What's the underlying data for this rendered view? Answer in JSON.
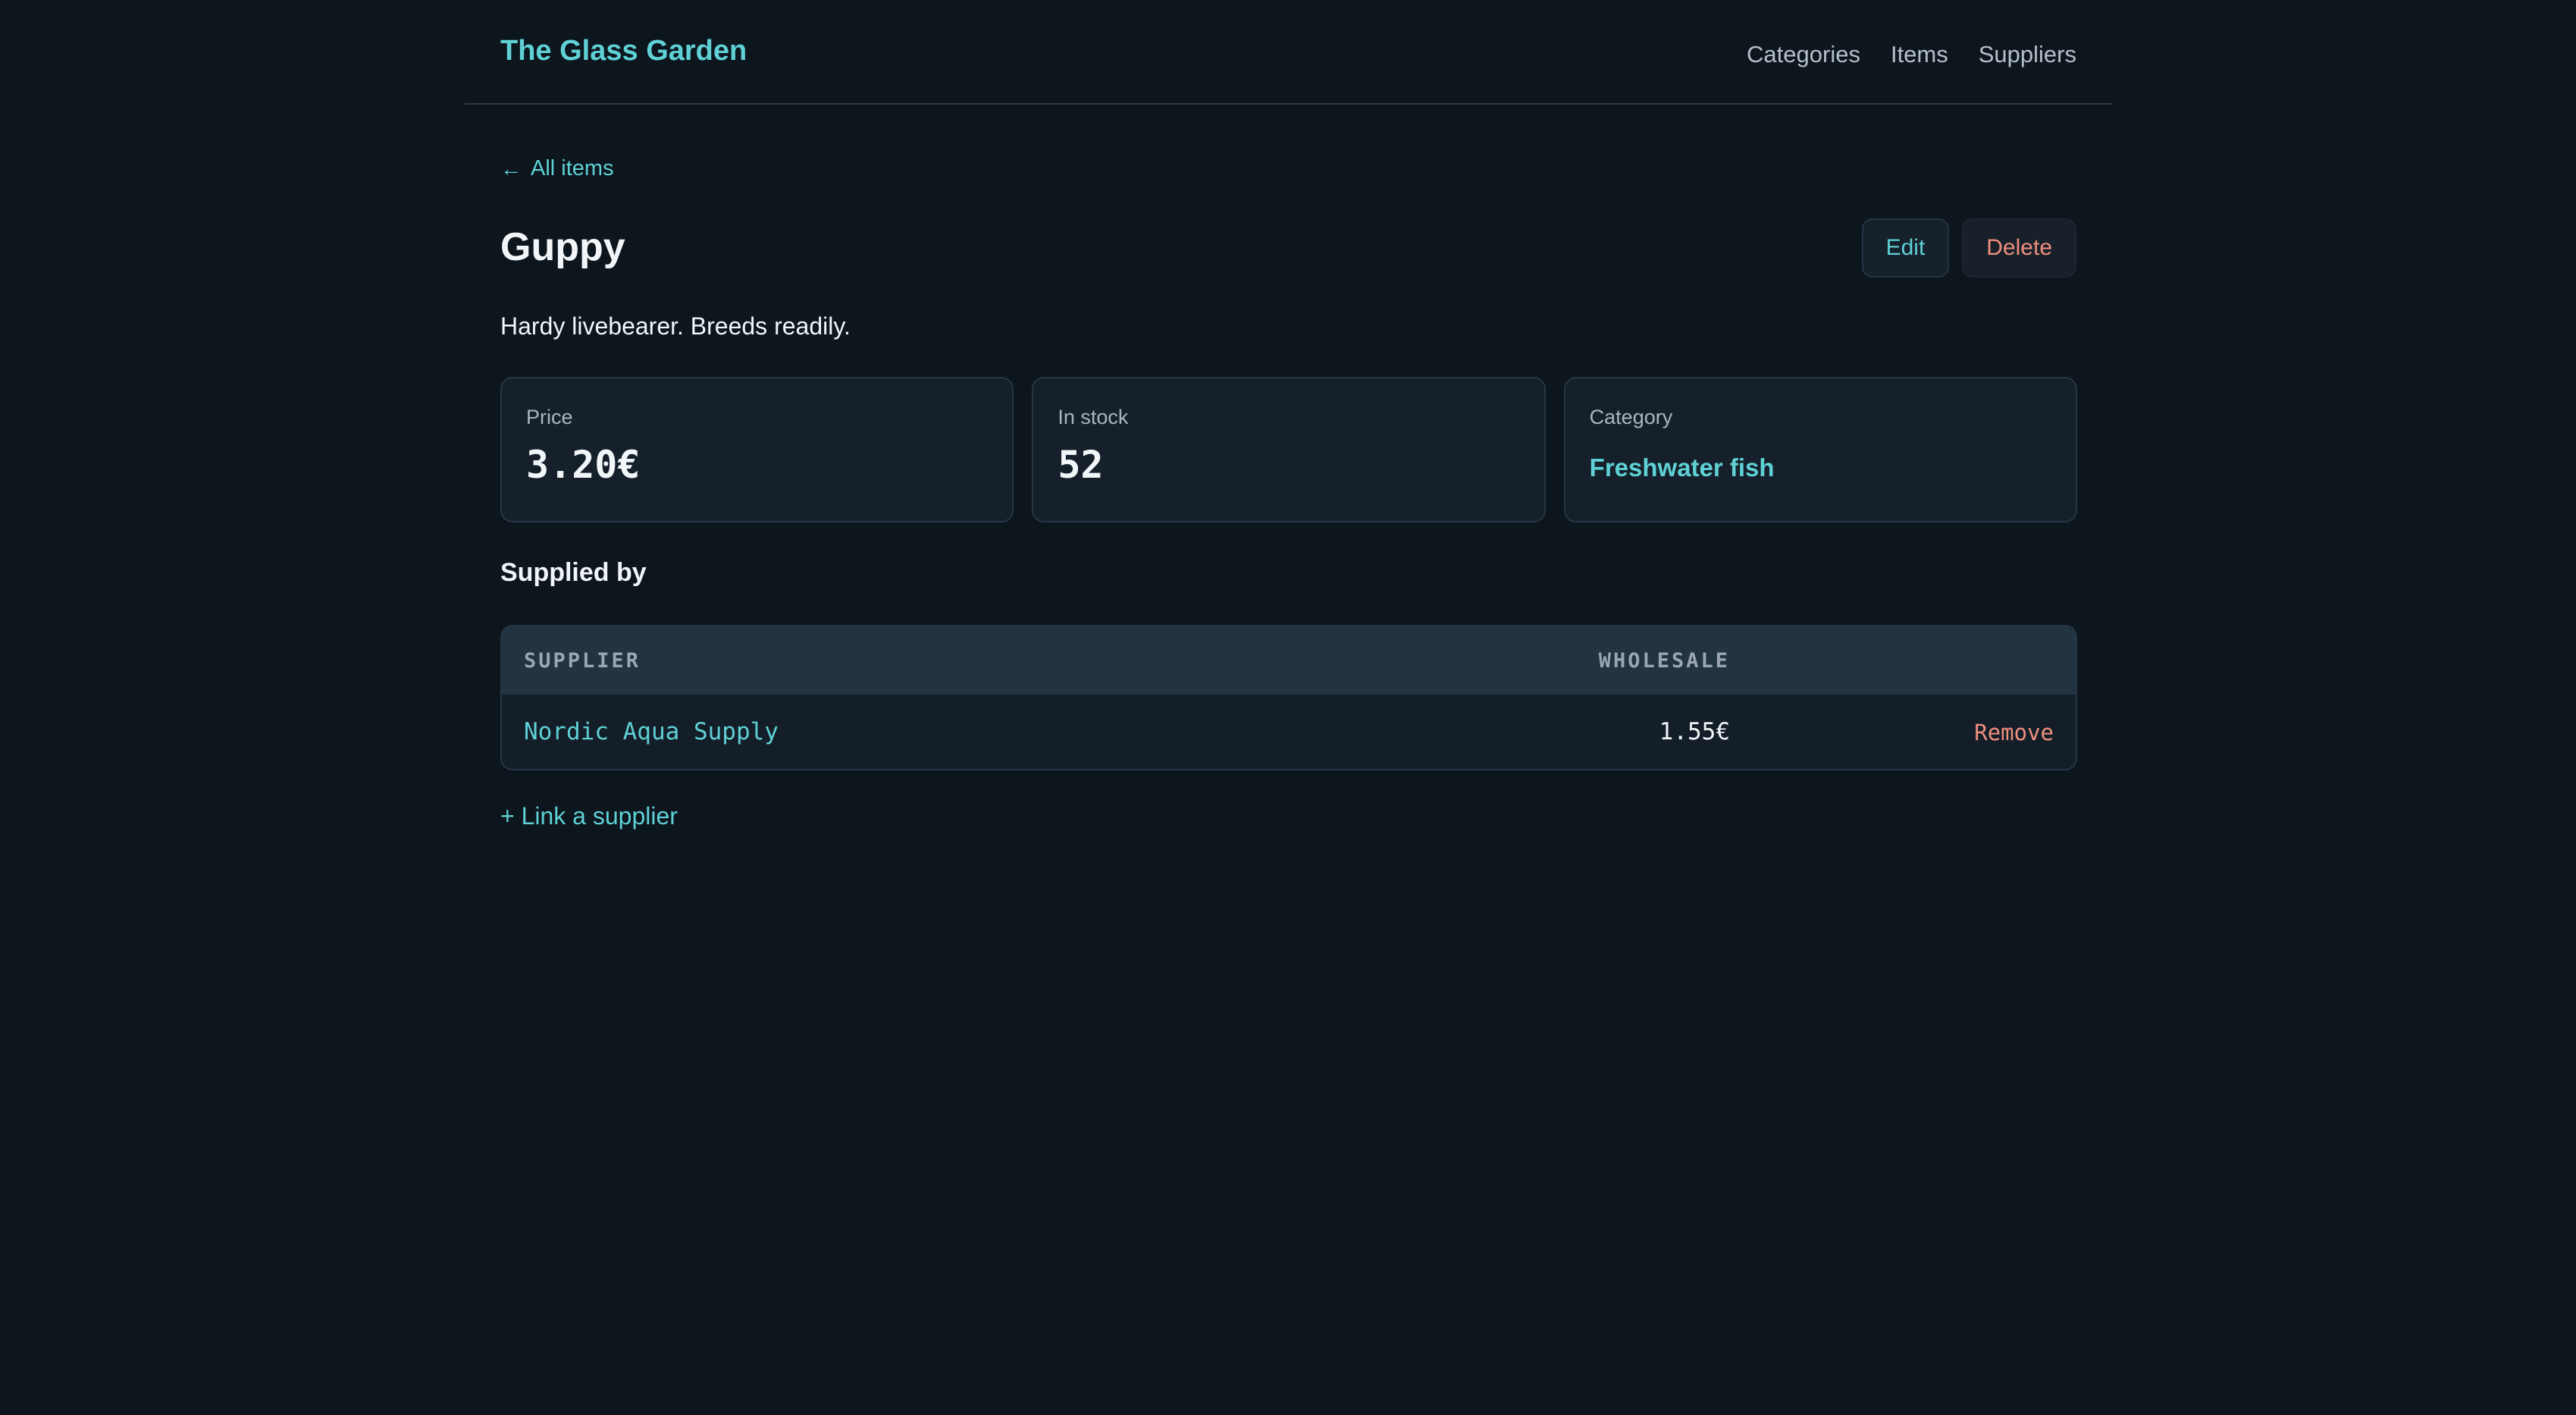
{
  "header": {
    "brand": "The Glass Garden",
    "nav": [
      "Categories",
      "Items",
      "Suppliers"
    ]
  },
  "back_link": {
    "icon": "arrow-left-icon",
    "label": "All items"
  },
  "item": {
    "name": "Guppy",
    "description": "Hardy livebearer. Breeds readily."
  },
  "actions": {
    "edit_label": "Edit",
    "delete_label": "Delete"
  },
  "stats": {
    "price_label": "Price",
    "price_value": "3.20€",
    "stock_label": "In stock",
    "stock_value": "52",
    "category_label": "Category",
    "category_value": "Freshwater fish"
  },
  "suppliers": {
    "section_title": "Supplied by",
    "columns": [
      "SUPPLIER",
      "WHOLESALE"
    ],
    "rows": [
      {
        "supplier": "Nordic Aqua Supply",
        "wholesale": "1.55€",
        "action": "Remove"
      }
    ],
    "link_label": "+ Link a supplier"
  },
  "colors": {
    "background": "#0d151d",
    "accent": "#5fd1d6",
    "danger": "#f08f7f",
    "card": "#15202a"
  }
}
